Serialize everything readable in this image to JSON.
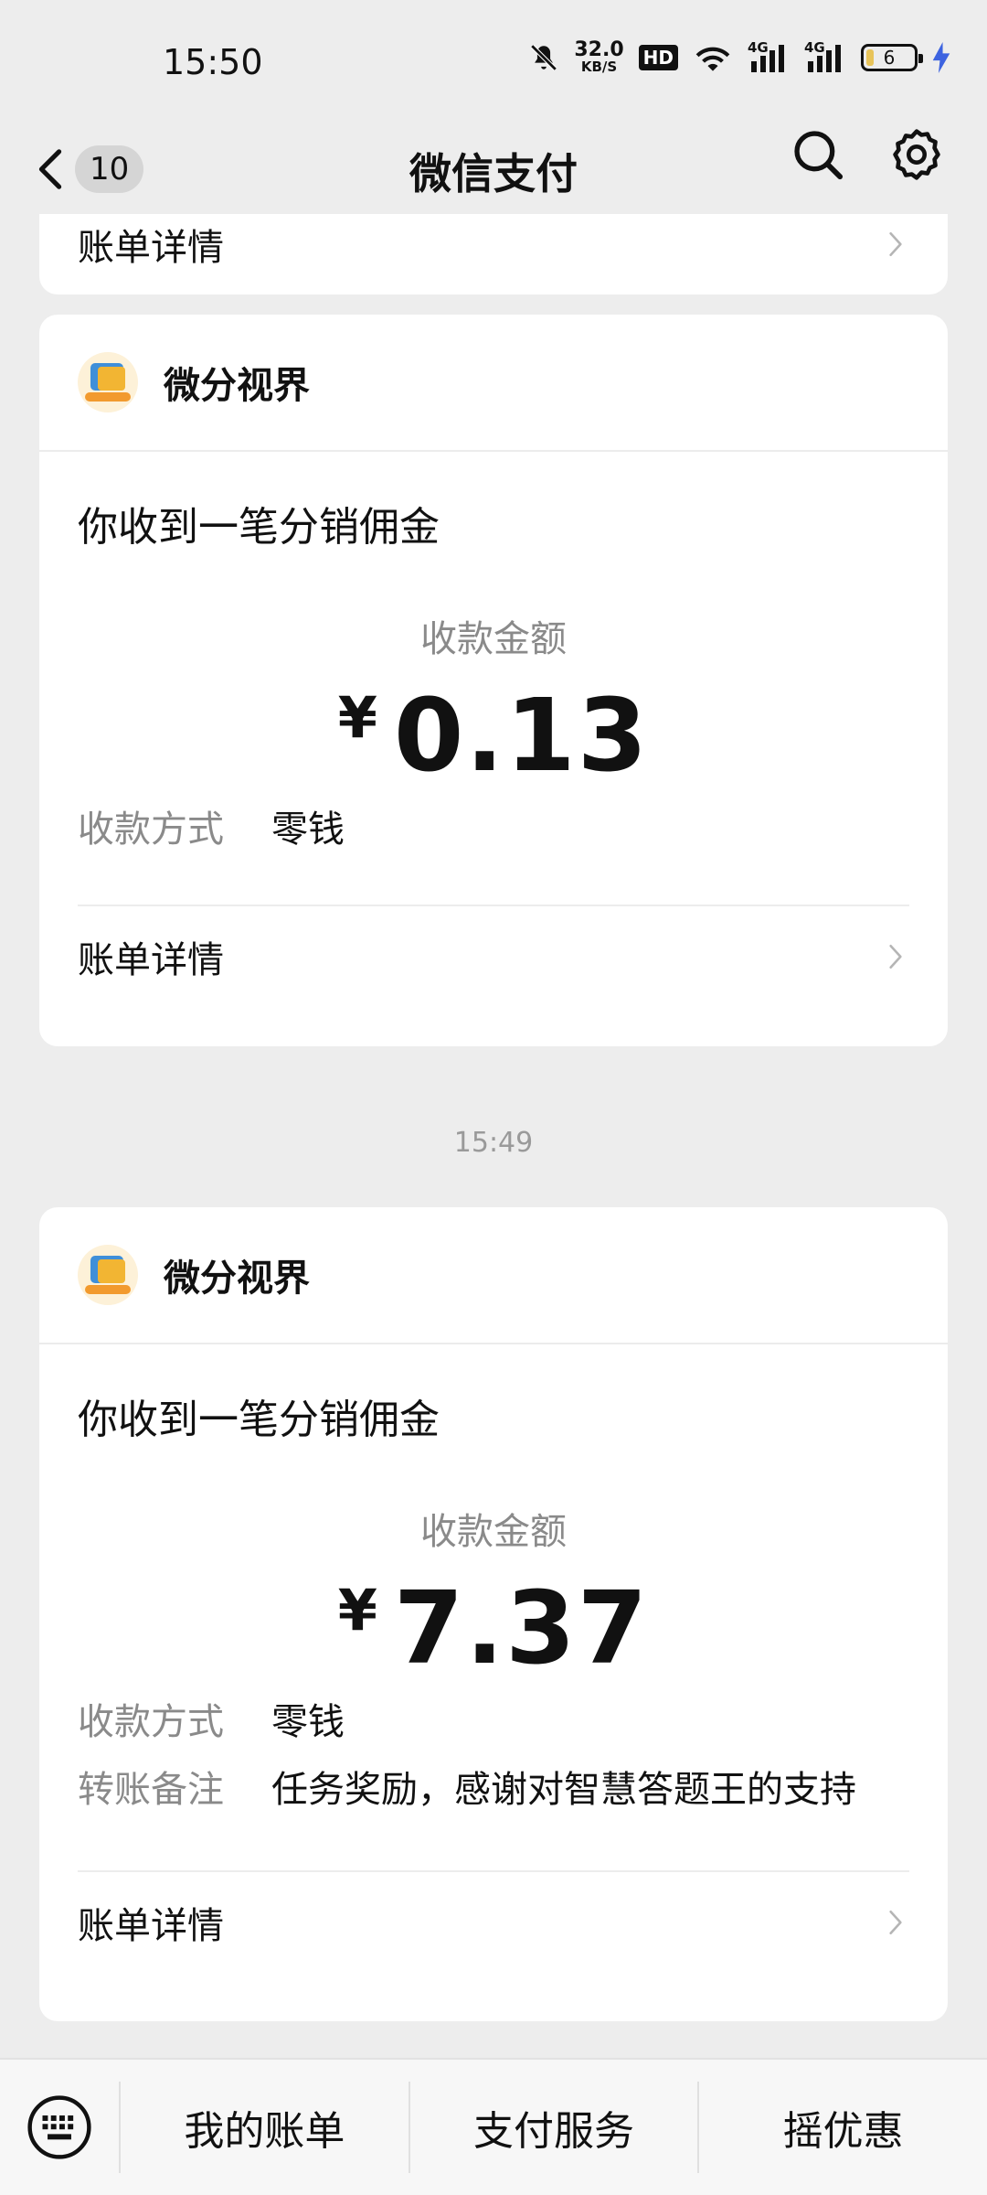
{
  "status_bar": {
    "time": "15:50",
    "net_speed_value": "32.0",
    "net_speed_unit": "KB/S",
    "hd_label": "HD",
    "network_1": "4G",
    "network_2": "4G",
    "battery_level": "6",
    "icons": [
      "mute-icon",
      "wifi-icon",
      "signal-icon",
      "battery-icon",
      "charging-icon"
    ]
  },
  "nav": {
    "back_count": "10",
    "title": "微信支付",
    "icons": [
      "back-arrow-icon",
      "search-icon",
      "settings-icon"
    ]
  },
  "top_card": {
    "detail_label": "账单详情"
  },
  "cards": [
    {
      "merchant": "微分视界",
      "title": "你收到一笔分销佣金",
      "amount_label": "收款金额",
      "currency": "¥",
      "amount": "0.13",
      "method_key": "收款方式",
      "method_value": "零钱",
      "detail_label": "账单详情"
    },
    {
      "merchant": "微分视界",
      "title": "你收到一笔分销佣金",
      "amount_label": "收款金额",
      "currency": "¥",
      "amount": "7.37",
      "method_key": "收款方式",
      "method_value": "零钱",
      "note_key": "转账备注",
      "note_value": "任务奖励，感谢对智慧答题王的支持",
      "detail_label": "账单详情"
    }
  ],
  "timestamp": "15:49",
  "bottom_menu": {
    "items": [
      "我的账单",
      "支付服务",
      "摇优惠"
    ],
    "icons": [
      "keyboard-icon"
    ]
  },
  "colors": {
    "background": "#ededed",
    "card": "#ffffff",
    "muted_text": "#8a8a8a",
    "charging": "#3d63e0"
  }
}
